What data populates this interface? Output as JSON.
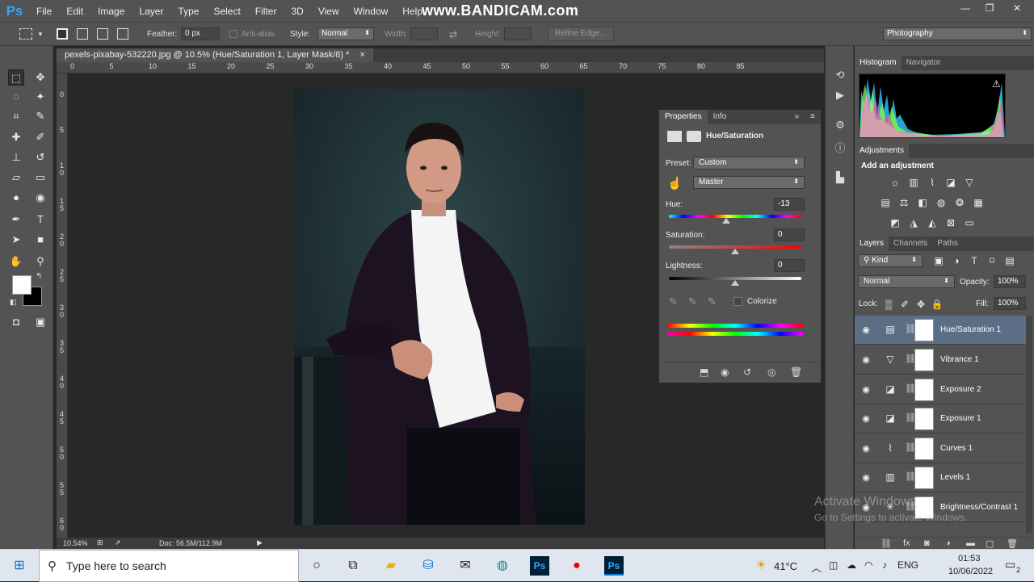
{
  "menubar": {
    "logo": "Ps",
    "items": [
      "File",
      "Edit",
      "Image",
      "Layer",
      "Type",
      "Select",
      "Filter",
      "3D",
      "View",
      "Window",
      "Help"
    ],
    "watermark": "www.BANDICAM.com",
    "window_buttons": [
      "—",
      "❐",
      "✕"
    ]
  },
  "options": {
    "feather_label": "Feather:",
    "feather_value": "0 px",
    "antialias_label": "Anti-alias",
    "style_label": "Style:",
    "style_value": "Normal",
    "width_label": "Width:",
    "height_label": "Height:",
    "refine_label": "Refine Edge...",
    "workspace": "Photography"
  },
  "document": {
    "tab_title": "pexels-pixabay-532220.jpg @ 10.5% (Hue/Saturation 1, Layer Mask/8) *",
    "close": "×",
    "zoom": "10.54%",
    "doc_info": "Doc: 56.5M/112.9M"
  },
  "ruler": {
    "h_ticks": [
      "0",
      "5",
      "10",
      "15",
      "20",
      "25",
      "30",
      "35",
      "40",
      "45",
      "50",
      "55",
      "60",
      "65",
      "70",
      "75",
      "80",
      "85"
    ],
    "v_ticks": [
      "0",
      "5",
      "1 0",
      "1 5",
      "2 0",
      "2 5",
      "3 0",
      "3 5",
      "4 0",
      "4 5",
      "5 0",
      "5 5",
      "6 0"
    ]
  },
  "properties": {
    "tabs": [
      "Properties",
      "Info"
    ],
    "title": "Hue/Saturation",
    "preset_label": "Preset:",
    "preset_value": "Custom",
    "channel_value": "Master",
    "hue_label": "Hue:",
    "hue_value": "-13",
    "saturation_label": "Saturation:",
    "saturation_value": "0",
    "lightness_label": "Lightness:",
    "lightness_value": "0",
    "colorize_label": "Colorize"
  },
  "histogram": {
    "tabs": [
      "Histogram",
      "Navigator"
    ],
    "warning_icon": "⚠"
  },
  "adjustments": {
    "header": "Adjustments",
    "title": "Add an adjustment"
  },
  "layers": {
    "tabs": [
      "Layers",
      "Channels",
      "Paths"
    ],
    "filter_value": "Kind",
    "blend_mode": "Normal",
    "opacity_label": "Opacity:",
    "opacity_value": "100%",
    "lock_label": "Lock:",
    "fill_label": "Fill:",
    "fill_value": "100%",
    "rows": [
      {
        "name": "Hue/Saturation 1",
        "icon": "▤",
        "selected": true
      },
      {
        "name": "Vibrance 1",
        "icon": "▽",
        "selected": false
      },
      {
        "name": "Exposure 2",
        "icon": "◪",
        "selected": false
      },
      {
        "name": "Exposure 1",
        "icon": "◪",
        "selected": false
      },
      {
        "name": "Curves 1",
        "icon": "⌇",
        "selected": false
      },
      {
        "name": "Levels 1",
        "icon": "▥",
        "selected": false
      },
      {
        "name": "Brightness/Contrast 1",
        "icon": "✳",
        "selected": false
      }
    ]
  },
  "windows_overlay": {
    "line1": "Activate Windows",
    "line2": "Go to Settings to activate Windows."
  },
  "taskbar": {
    "search_placeholder": "Type here to search",
    "weather": "41°C",
    "language": "ENG",
    "time": "01:53",
    "date": "10/06/2022",
    "notification_count": "2"
  },
  "colors": {
    "ps_blue": "#31a8ff",
    "panel_bg": "#535353",
    "selected_layer": "#5c6e86"
  }
}
